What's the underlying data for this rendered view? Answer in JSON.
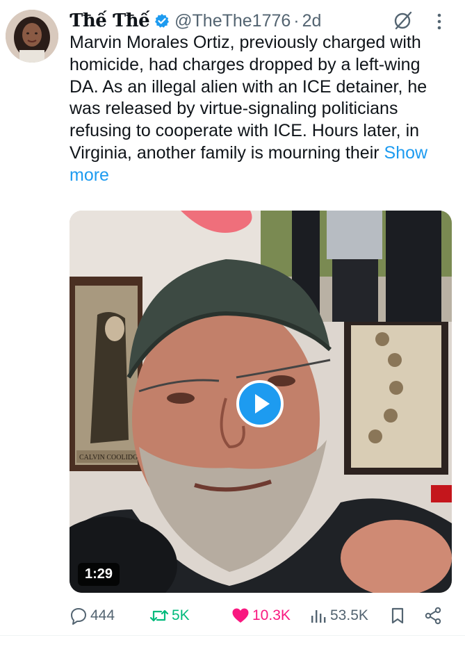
{
  "tweet": {
    "author_name": "Ƭħế Ƭħế",
    "handle": "@TheThe1776",
    "separator": "·",
    "time": "2d",
    "text": "Marvin Morales Ortiz, previously charged with homicide, had charges dropped by a left-wing DA.  As an illegal alien with an ICE detainer, he was released by virtue-signaling politicians refusing to cooperate with ICE. Hours later, in Virginia, another family is mourning their",
    "show_more": "Show more",
    "video_duration": "1:29",
    "portrait_caption": "CALVIN COOLIDGE",
    "icons": {
      "verified": "verified-badge-icon",
      "grok": "grok-icon",
      "more": "more-options-icon",
      "reply": "reply-icon",
      "retweet": "retweet-icon",
      "like": "like-heart-icon",
      "views": "views-icon",
      "bookmark": "bookmark-icon",
      "share": "share-icon",
      "play": "play-icon"
    }
  },
  "actions": {
    "replies": "444",
    "retweets": "5K",
    "likes": "10.3K",
    "views": "53.5K"
  },
  "colors": {
    "accent": "#1d9bf0",
    "retweet": "#00ba7c",
    "like": "#f91880",
    "muted": "#536471",
    "text": "#0f1419"
  }
}
